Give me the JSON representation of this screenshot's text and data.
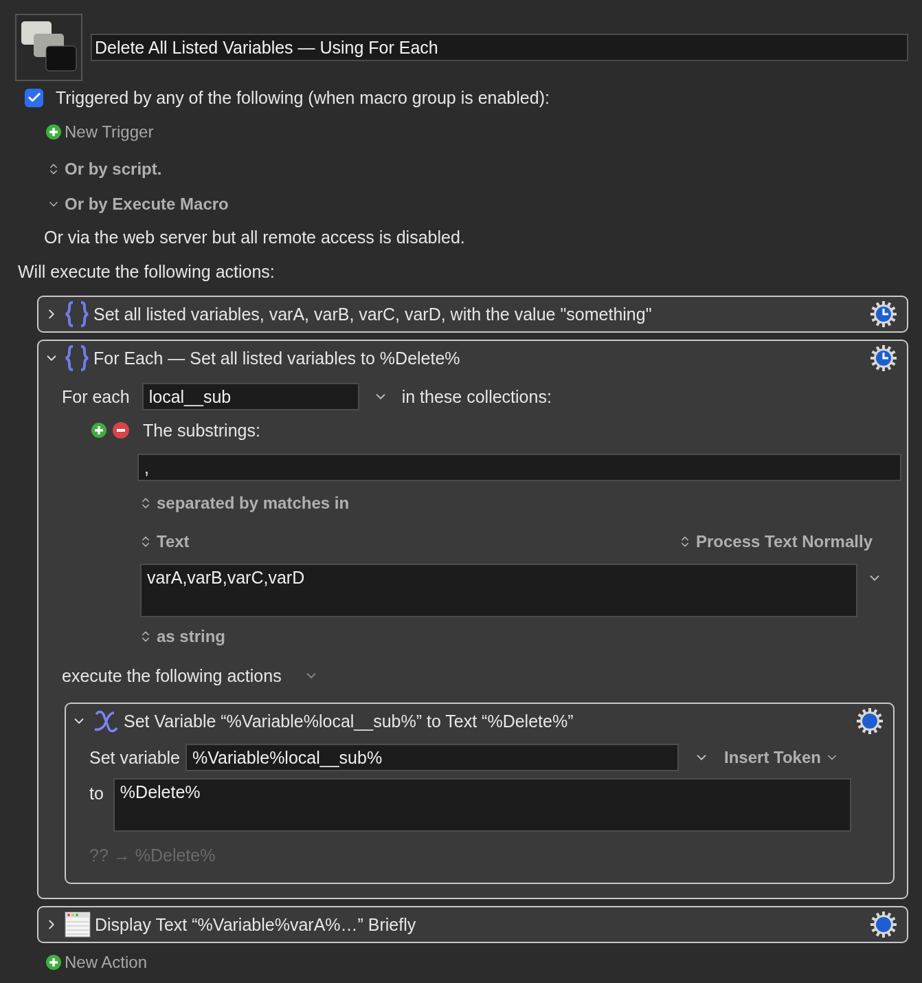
{
  "macro": {
    "name": "Delete All Listed Variables — Using For Each"
  },
  "trigger_header": {
    "label": "Triggered by any of the following (when macro group is enabled):",
    "checked": true
  },
  "new_trigger": "New Trigger",
  "options": [
    {
      "kind": "updown",
      "label": "Or by script."
    },
    {
      "kind": "disclosure",
      "label": "Or by Execute Macro"
    }
  ],
  "web_note": "Or via the web server but all remote access is disabled.",
  "actions_heading": "Will execute the following actions:",
  "actions": [
    {
      "kind": "braces",
      "title": "Set all listed variables, varA, varB, varC, varD, with the value \"something\"",
      "expanded": false
    },
    {
      "kind": "foreach",
      "title": "For Each — Set all listed variables to %Delete%",
      "expanded": true,
      "body": {
        "label": "For each",
        "variable": "local__sub",
        "collections_label": "in these collections:",
        "collection_label": "The substrings:",
        "source_value": ",",
        "separator_option": "separated by matches in",
        "text_option": "Text",
        "process_option": "Process Text Normally",
        "text_value": "varA,varB,varC,varD",
        "as_option": "as string",
        "execute_label": "execute the following actions",
        "sub_actions": [
          {
            "kind": "setvar",
            "title": "Set Variable “%Variable%local__sub%” to Text “%Delete%”",
            "expanded": true,
            "var_label": "Set variable",
            "var_value": "%Variable%local__sub%",
            "token_button": "Insert Token",
            "to_label": "to",
            "to_value": "%Delete%",
            "preview": "?? → %Delete%"
          }
        ]
      }
    },
    {
      "kind": "display",
      "title": "Display Text “%Variable%varA%…” Briefly",
      "expanded": false
    }
  ],
  "new_action": "New Action"
}
